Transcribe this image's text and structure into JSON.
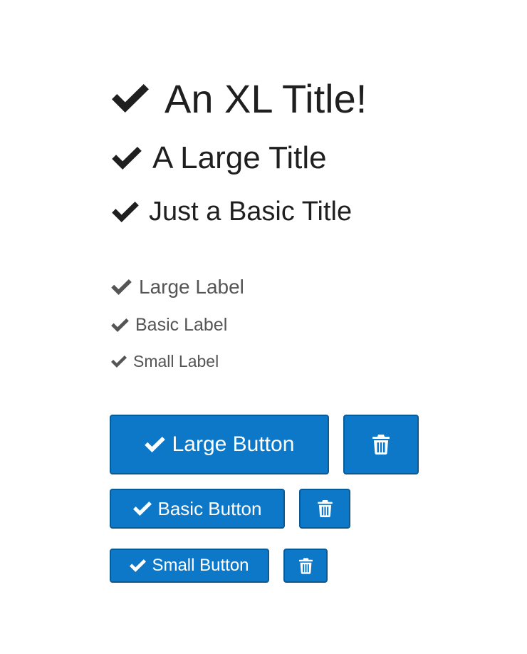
{
  "titles": {
    "xl": "An XL Title!",
    "large": "A Large Title",
    "basic": "Just a Basic Title"
  },
  "labels": {
    "large": "Large Label",
    "basic": "Basic Label",
    "small": "Small Label"
  },
  "buttons": {
    "large": "Large Button",
    "basic": "Basic Button",
    "small": "Small Button"
  },
  "icons": {
    "check": "check-icon",
    "delete": "trash-icon"
  },
  "colors": {
    "title_text": "#1f1f1f",
    "label_text": "#555555",
    "button_bg": "#0e78c8",
    "button_border": "#0a5a95",
    "button_text": "#ffffff"
  }
}
